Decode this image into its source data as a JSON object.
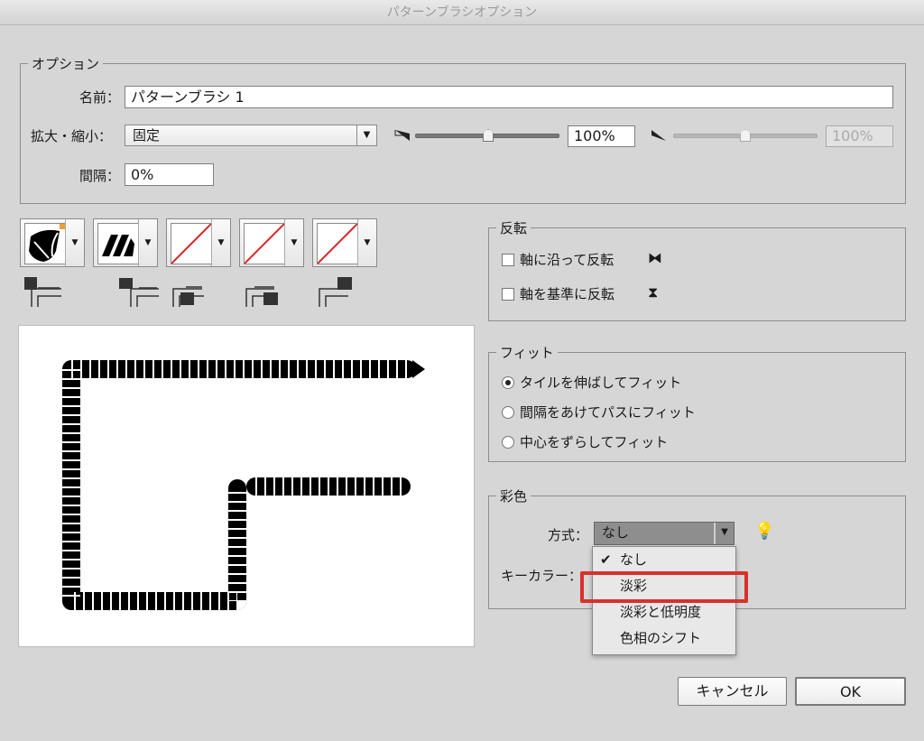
{
  "window": {
    "title": "パターンブラシオプション"
  },
  "options": {
    "legend": "オプション",
    "name_label": "名前：",
    "name_value": "パターンブラシ 1",
    "scale_label": "拡大・縮小：",
    "scale_value": "固定",
    "scale_min": "100%",
    "scale_max": "100%",
    "spacing_label": "間隔：",
    "spacing_value": "0%"
  },
  "tiles": [
    "side-tile",
    "outer-corner-tile",
    "inner-corner-tile",
    "start-tile",
    "end-tile"
  ],
  "reflect": {
    "legend": "反転",
    "along": "軸に沿って反転",
    "across": "軸を基準に反転"
  },
  "fit": {
    "legend": "フィット",
    "options": [
      "タイルを伸ばしてフィット",
      "間隔をあけてパスにフィット",
      "中心をずらしてフィット"
    ],
    "selected": 0
  },
  "colorization": {
    "legend": "彩色",
    "method_label": "方式：",
    "method_value": "なし",
    "key_color_label": "キーカラー：",
    "menu": [
      "なし",
      "淡彩",
      "淡彩と低明度",
      "色相のシフト"
    ],
    "checked": 0,
    "highlighted": 1,
    "highlight_color": "#d9302c"
  },
  "buttons": {
    "cancel": "キャンセル",
    "ok": "OK"
  }
}
